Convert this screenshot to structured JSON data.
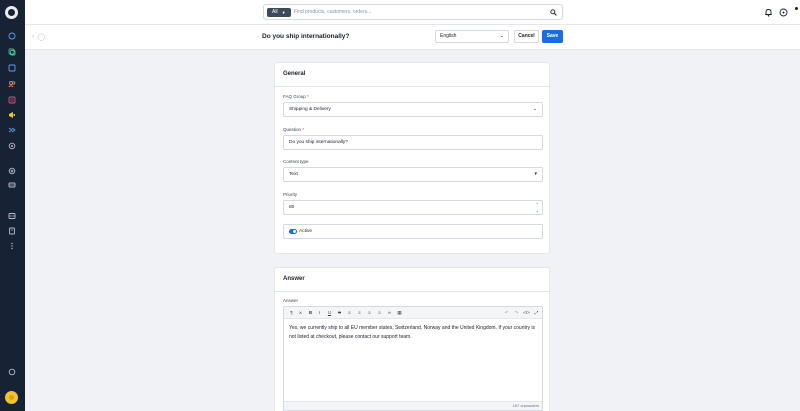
{
  "search": {
    "scope_label": "All",
    "placeholder": "Find products, customers, orders..."
  },
  "page": {
    "title": "Do you ship internationally?"
  },
  "language": {
    "selected": "English"
  },
  "actions": {
    "cancel_label": "Cancel",
    "save_label": "Save"
  },
  "general": {
    "title": "General",
    "faq_group": {
      "label": "FAQ Group",
      "required_mark": "*",
      "value": "Shipping & Delivery"
    },
    "question": {
      "label": "Question",
      "required_mark": "*",
      "value": "Do you ship internationally?"
    },
    "content_type": {
      "label": "Content type",
      "value": "Text"
    },
    "priority": {
      "label": "Priority",
      "value": "80"
    },
    "active": {
      "label": "Active",
      "checked": true
    }
  },
  "answer": {
    "title": "Answer",
    "field_label": "Answer",
    "text": "Yes, we currently ship to all EU member states, Switzerland, Norway and the United Kingdom. If your country is not listed at checkout, please contact our support team.",
    "char_count": "167 characters"
  },
  "colors": {
    "sidebar_bg": "#182235",
    "primary": "#1d6ae5",
    "avatar": "#f2c230"
  },
  "icons": {
    "sidebar": [
      "dashboard-icon",
      "catalog-icon",
      "orders-icon",
      "customers-icon",
      "content-icon",
      "marketing-icon",
      "promotions-icon",
      "settings-icon",
      "extensions-icon",
      "sales-channels-icon",
      "storage-icon",
      "reports-icon",
      "more-icon",
      "help-icon"
    ],
    "toolbar": [
      "paragraph-icon",
      "clear-format-icon",
      "bold-icon",
      "italic-icon",
      "underline-icon",
      "strikethrough-icon",
      "align-icon",
      "list-icon",
      "ordered-list-icon",
      "indent-icon",
      "link-icon",
      "table-icon",
      "undo-icon",
      "redo-icon",
      "code-icon",
      "expand-icon"
    ]
  }
}
